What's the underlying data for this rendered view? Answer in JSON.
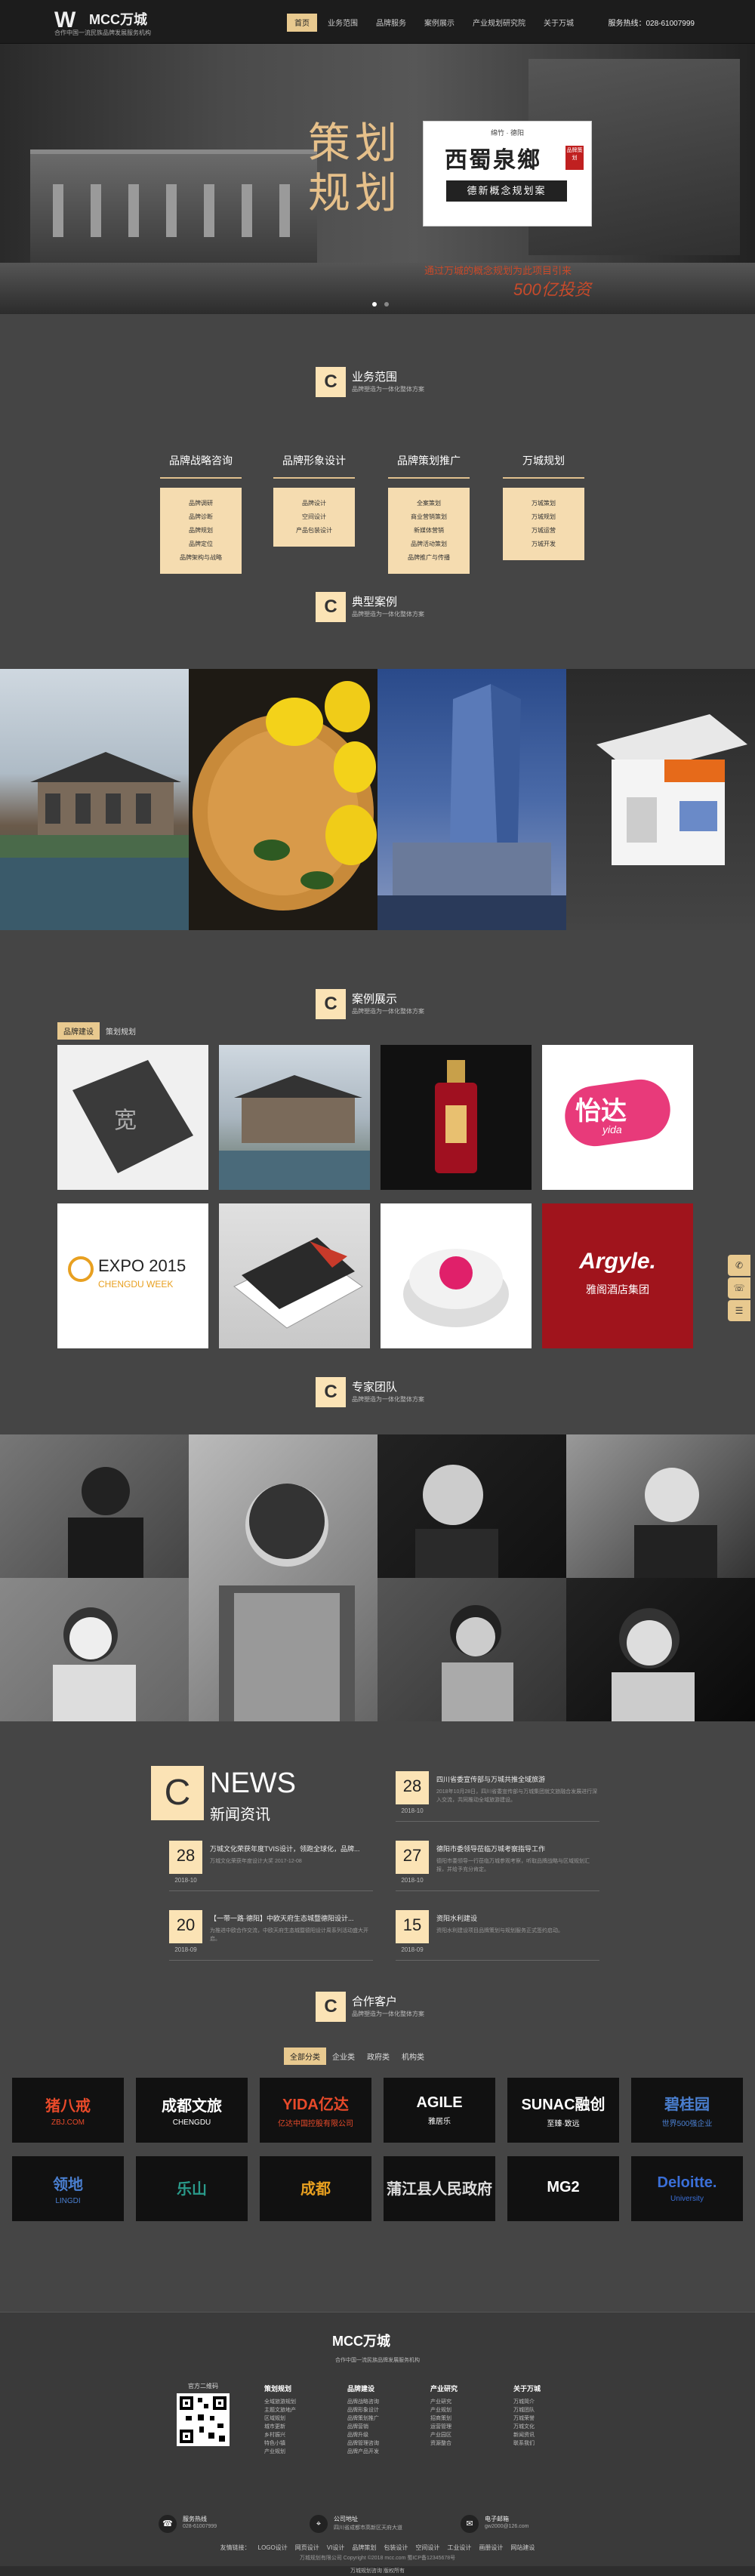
{
  "header": {
    "logo_mark": "W",
    "logo_text": "MCC万城",
    "logo_sub": "合作中国一流民族品牌发展服务机构",
    "nav": [
      "首页",
      "业务范围",
      "品牌服务",
      "案例展示",
      "产业规划研究院",
      "关于万城"
    ],
    "hotline": "服务热线：028-61007999"
  },
  "banner": {
    "big_title": "策划规划",
    "card_small": "绵竹 · 德阳",
    "card_name": "西蜀泉鄉",
    "card_seal": "品牌策划",
    "card_bar": "德新概念规划案",
    "tagline": "通过万城的概念规划为此项目引来",
    "tagline2": "500亿投资"
  },
  "sections": {
    "c": "C",
    "services": {
      "title": "业务范围",
      "sub": "品牌塑造为一体化整体方案"
    },
    "typical": {
      "title": "典型案例",
      "sub": "品牌塑造为一体化整体方案"
    },
    "showcase": {
      "title": "案例展示",
      "sub": "品牌塑造为一体化整体方案"
    },
    "team": {
      "title": "专家团队",
      "sub": "品牌塑造为一体化整体方案"
    },
    "partners": {
      "title": "合作客户",
      "sub": "品牌塑造为一体化整体方案"
    }
  },
  "services": [
    {
      "title": "品牌战略咨询",
      "items": [
        "品牌调研",
        "品牌诊断",
        "品牌规划",
        "品牌定位",
        "品牌架构与战略"
      ]
    },
    {
      "title": "品牌形象设计",
      "items": [
        "品牌设计",
        "空间设计",
        "产品包装设计"
      ]
    },
    {
      "title": "品牌策划推广",
      "items": [
        "全案策划",
        "商业营销策划",
        "新媒体营销",
        "品牌活动策划",
        "品牌推广与传播"
      ]
    },
    {
      "title": "万城规划",
      "items": [
        "万城策划",
        "万城规划",
        "万城运营",
        "万城开发"
      ]
    }
  ],
  "showcase_tabs": [
    "品牌建设",
    "策划规划"
  ],
  "showcase": {
    "yida": "怡达",
    "yida_en": "yida",
    "expo": "EXPO 2015",
    "expo_sub": "CHENGDU WEEK",
    "argyle": "Argyle.",
    "argyle_cn": "雅阁酒店集团"
  },
  "news": {
    "head_c": "C",
    "head_en": "NEWS",
    "head_cn": "新闻资讯",
    "items": [
      {
        "day": "28",
        "ym": "2018-10",
        "title": "四川省委宣传部与万城共推全域旅游",
        "sum": "2018年10月28日，四川省委宣传部与万城集团就文旅融合发展进行深入交流，共同推动全域旅游建设。"
      },
      {
        "day": "28",
        "ym": "2018-10",
        "title": "万城文化荣获年度TVIS设计，领跑全球化，品牌...",
        "sum": "万城文化荣获年度设计大奖 2017-12-08"
      },
      {
        "day": "27",
        "ym": "2018-10",
        "title": "德阳市委领导莅临万城考察指导工作",
        "sum": "德阳市委领导一行莅临万城参观考察，听取品牌战略与区域规划汇报，并给予充分肯定。"
      },
      {
        "day": "20",
        "ym": "2018-09",
        "title": "【一带一路·德阳】中欧天府生态城暨德阳设计...",
        "sum": "为推进中欧合作交流，中欧天府生态城暨德阳设计周系列活动盛大开启。"
      },
      {
        "day": "15",
        "ym": "2018-09",
        "title": "资阳水利建设",
        "sum": "资阳水利建设项目品牌策划与规划服务正式签约启动。"
      }
    ]
  },
  "partner_tabs": [
    "全部分类",
    "企业类",
    "政府类",
    "机构类"
  ],
  "partners": [
    {
      "text": "猪八戒",
      "sub": "ZBJ.COM",
      "color": "#e84a2a"
    },
    {
      "text": "成都文旅",
      "sub": "CHENGDU",
      "color": "#ffffff"
    },
    {
      "text": "YIDA亿达",
      "sub": "亿达中国控股有限公司",
      "color": "#e84a2a"
    },
    {
      "text": "AGILE",
      "sub": "雅居乐",
      "color": "#ffffff"
    },
    {
      "text": "SUNAC融创",
      "sub": "至臻·致远",
      "color": "#ffffff"
    },
    {
      "text": "碧桂园",
      "sub": "世界500强企业",
      "color": "#4a7fd0"
    },
    {
      "text": "领地",
      "sub": "LINGDI",
      "color": "#4a7fd0"
    },
    {
      "text": "乐山",
      "sub": "",
      "color": "#2a9a8a"
    },
    {
      "text": "成都",
      "sub": "",
      "color": "#e8a020"
    },
    {
      "text": "蒲江县人民政府",
      "sub": "",
      "color": "#dddddd"
    },
    {
      "text": "MG2",
      "sub": "",
      "color": "#ffffff"
    },
    {
      "text": "Deloitte.",
      "sub": "University",
      "color": "#3a6fd8"
    }
  ],
  "footer": {
    "logo": "MCC万城",
    "sub": "合作中国一流民族品牌发展服务机构",
    "qr_label": "官方二维码",
    "cols": [
      {
        "h": "策划规划",
        "items": [
          "全域旅游规划",
          "主题文旅地产",
          "区域规划",
          "城市更新",
          "乡村振兴",
          "特色小镇",
          "产业规划"
        ]
      },
      {
        "h": "品牌建设",
        "items": [
          "品牌战略咨询",
          "品牌形象设计",
          "品牌策划推广",
          "品牌营销",
          "品牌升级",
          "品牌管理咨询",
          "品牌产品开发"
        ]
      },
      {
        "h": "产业研究",
        "items": [
          "产业研究",
          "产业规划",
          "招商策划",
          "运营管理",
          "产业园区",
          "资源整合"
        ]
      },
      {
        "h": "关于万城",
        "items": [
          "万城简介",
          "万城团队",
          "万城荣誉",
          "万城文化",
          "新闻资讯",
          "联系我们"
        ]
      }
    ],
    "contacts": [
      {
        "icon": "☎",
        "l1": "服务热线",
        "l2": "028-61007999"
      },
      {
        "icon": "⌖",
        "l1": "公司地址",
        "l2": "四川省成都市高新区天府大道"
      },
      {
        "icon": "✉",
        "l1": "电子邮箱",
        "l2": "gw2000@126.com"
      }
    ],
    "links": [
      "友情链接：",
      "LOGO设计",
      "网页设计",
      "VI设计",
      "品牌策划",
      "包装设计",
      "空间设计",
      "工业设计",
      "画册设计",
      "网站建设"
    ],
    "copy": "万城规划有限公司 Copyright ©2018 mcc.com 蜀ICP备12345678号",
    "bottom": "万城规划咨询 版权所有"
  },
  "float": {
    "btn1": "✆",
    "btn2": "☏",
    "btn3": "☰"
  }
}
